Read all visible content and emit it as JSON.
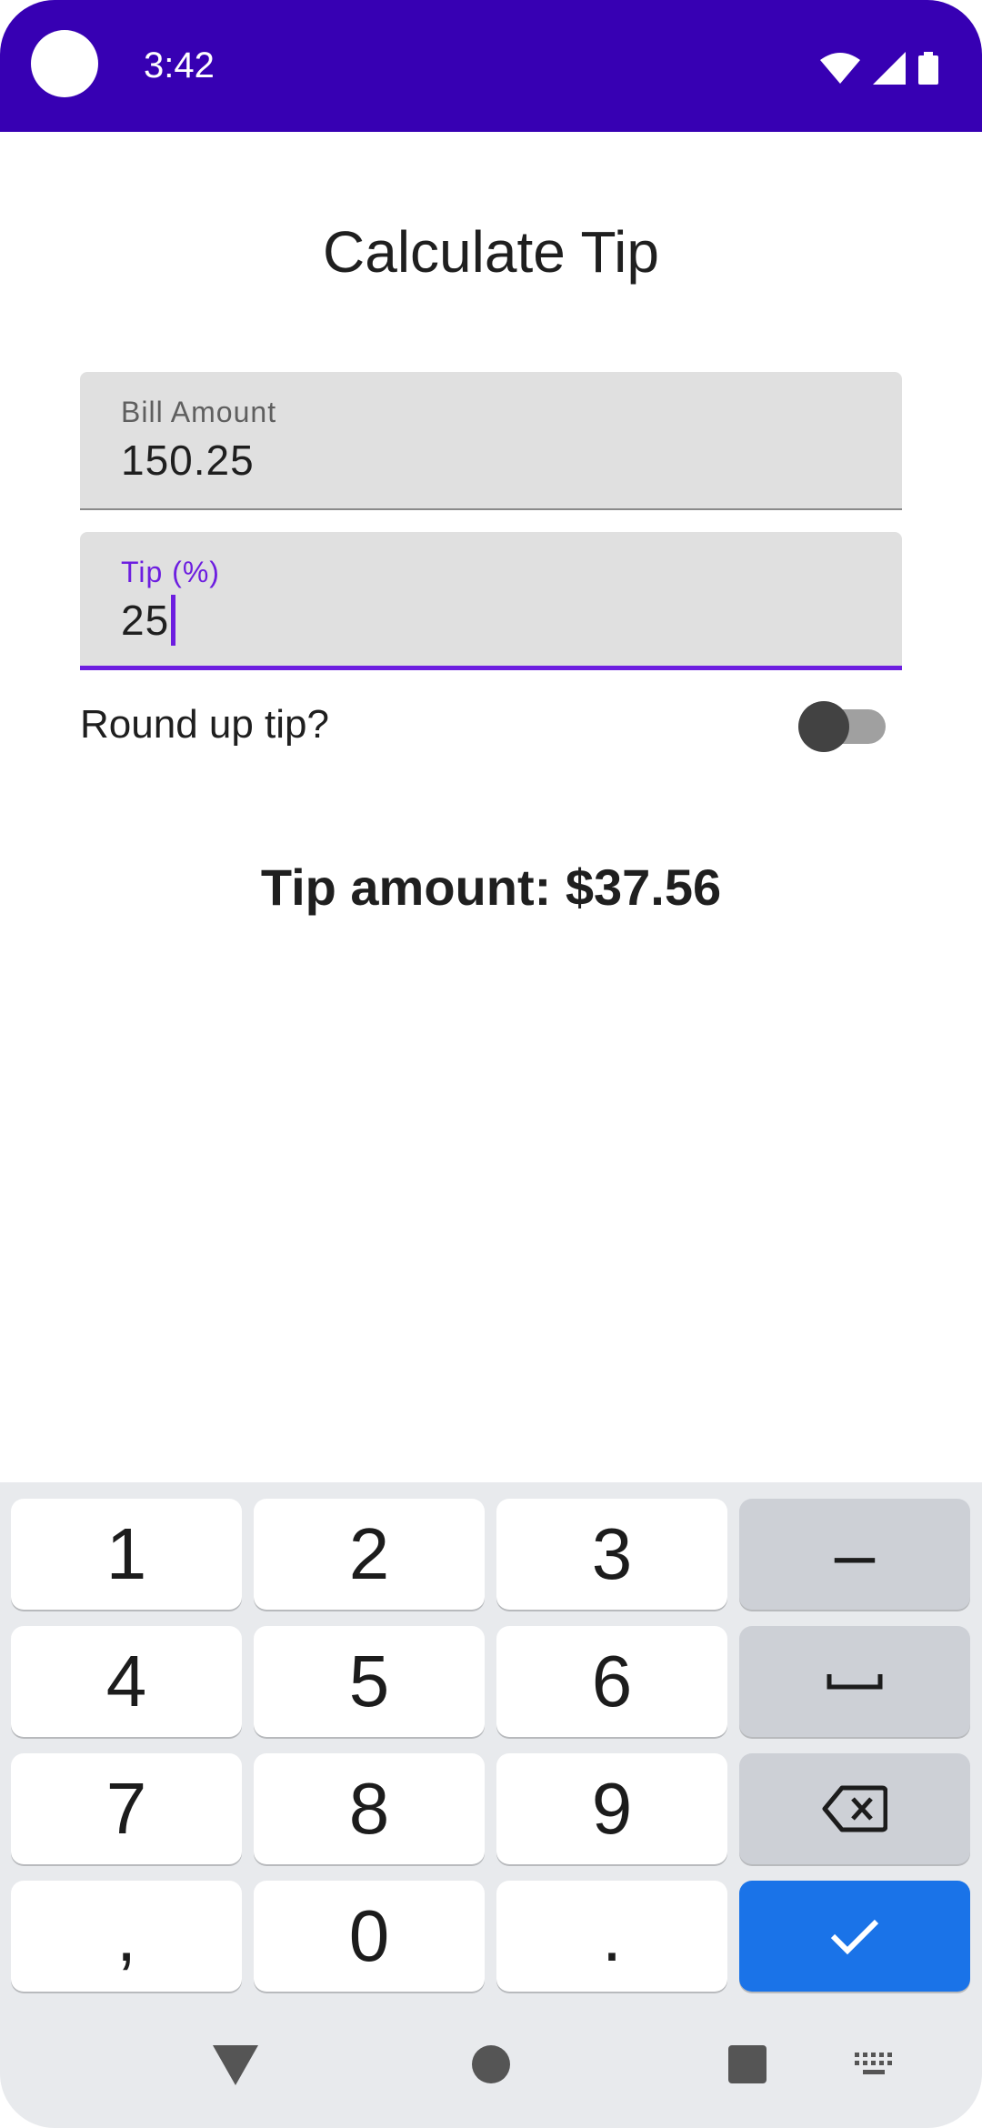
{
  "status": {
    "time": "3:42"
  },
  "screen": {
    "title": "Calculate Tip"
  },
  "bill": {
    "label": "Bill Amount",
    "value": "150.25"
  },
  "tip": {
    "label": "Tip (%)",
    "value": "25"
  },
  "round_up": {
    "label": "Round up tip?",
    "enabled": false
  },
  "result": {
    "text": "Tip amount: $37.56"
  },
  "keyboard": {
    "rows": [
      [
        "1",
        "2",
        "3",
        "–"
      ],
      [
        "4",
        "5",
        "6",
        "space-icon"
      ],
      [
        "7",
        "8",
        "9",
        "backspace-icon"
      ],
      [
        ",",
        "0",
        ".",
        "check-icon"
      ]
    ],
    "enter_color": "#1a73e8"
  },
  "nav": {
    "icons": [
      "back-icon",
      "home-icon",
      "recents-icon",
      "keyboard-switch-icon"
    ]
  },
  "colors": {
    "status_bar": "#3700b3",
    "accent": "#6d1ee0"
  }
}
